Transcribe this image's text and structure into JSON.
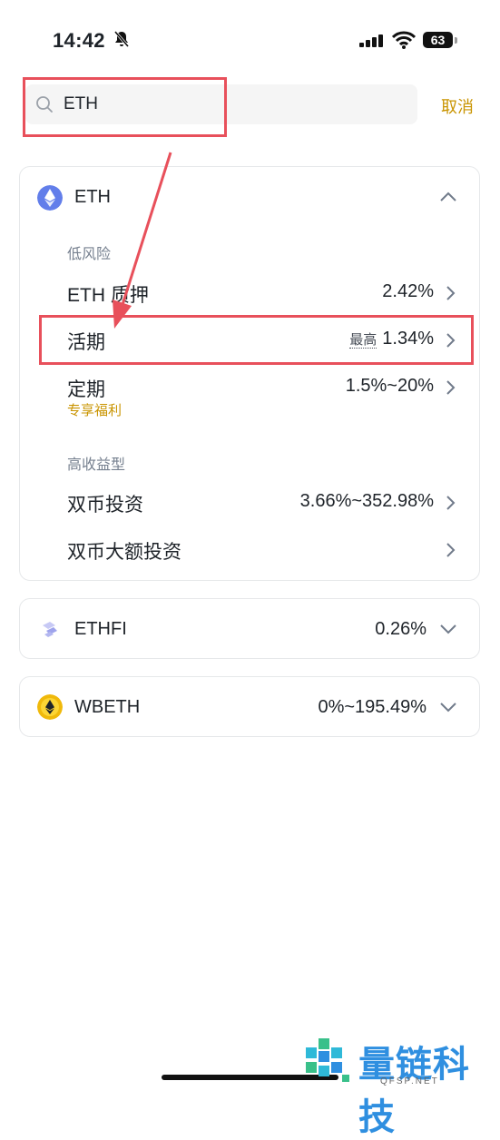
{
  "status_bar": {
    "time": "14:42",
    "battery": "63"
  },
  "search": {
    "query": "ETH",
    "cancel_label": "取消"
  },
  "eth_card": {
    "name": "ETH",
    "low_risk_label": "低风险",
    "high_yield_label": "高收益型",
    "rows": [
      {
        "label": "ETH 质押",
        "rate": "2.42%"
      },
      {
        "label": "活期",
        "rate_prefix": "最高",
        "rate": "1.34%"
      },
      {
        "label": "定期",
        "sub": "专享福利",
        "rate": "1.5%~20%"
      },
      {
        "label": "双币投资",
        "rate": "3.66%~352.98%"
      },
      {
        "label": "双币大额投资",
        "rate": ""
      }
    ]
  },
  "other_coins": [
    {
      "name": "ETHFI",
      "rate": "0.26%"
    },
    {
      "name": "WBETH",
      "rate": "0%~195.49%"
    }
  ],
  "watermark": {
    "name": "量链科技",
    "domain": "QFSP.NET"
  },
  "colors": {
    "accent": "#c99400",
    "highlight": "#e8505b",
    "eth": "#627eea",
    "wbeth": "#f0b90b"
  }
}
